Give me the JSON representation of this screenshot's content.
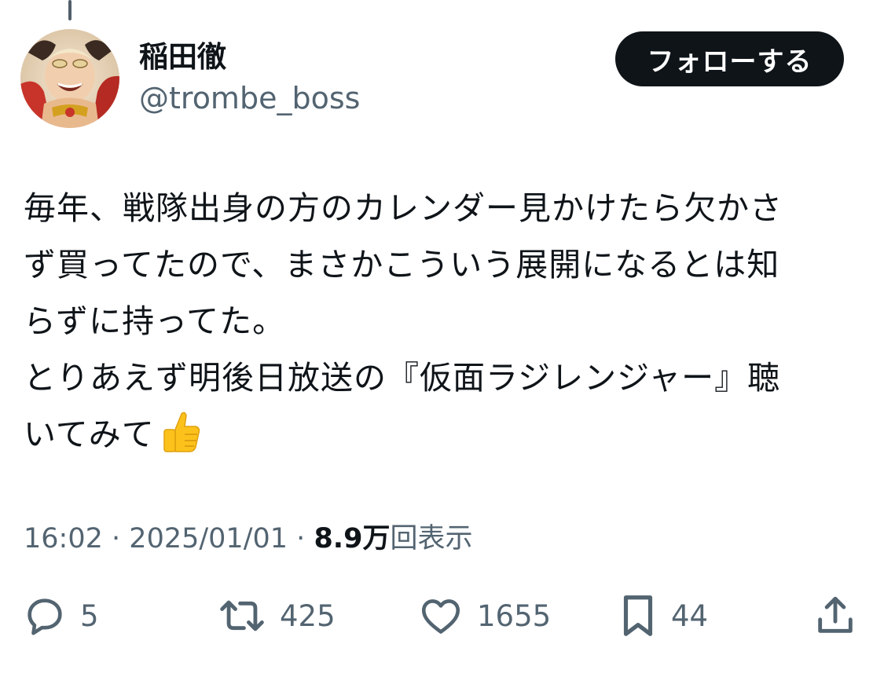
{
  "author": {
    "display_name": "稲田徹",
    "handle": "@trombe_boss",
    "follow_label": "フォローする"
  },
  "tweet": {
    "lines": [
      "毎年、戦隊出身の方のカレンダー見かけたら欠かさ",
      "ず買ってたので、まさかこういう展開になるとは知",
      "らずに持ってた。",
      "とりあえず明後日放送の『仮面ラジレンジャー』聴",
      "いてみて"
    ],
    "emoji": "thumbs-up"
  },
  "meta": {
    "time": "16:02",
    "separator": "·",
    "date": "2025/01/01",
    "views_count": "8.9万",
    "views_label": "回表示"
  },
  "actions": {
    "replies": "5",
    "retweets": "425",
    "likes": "1655",
    "bookmarks": "44"
  },
  "colors": {
    "text_primary": "#0f1419",
    "text_secondary": "#536471",
    "follow_bg": "#0f1419",
    "follow_text": "#ffffff"
  }
}
